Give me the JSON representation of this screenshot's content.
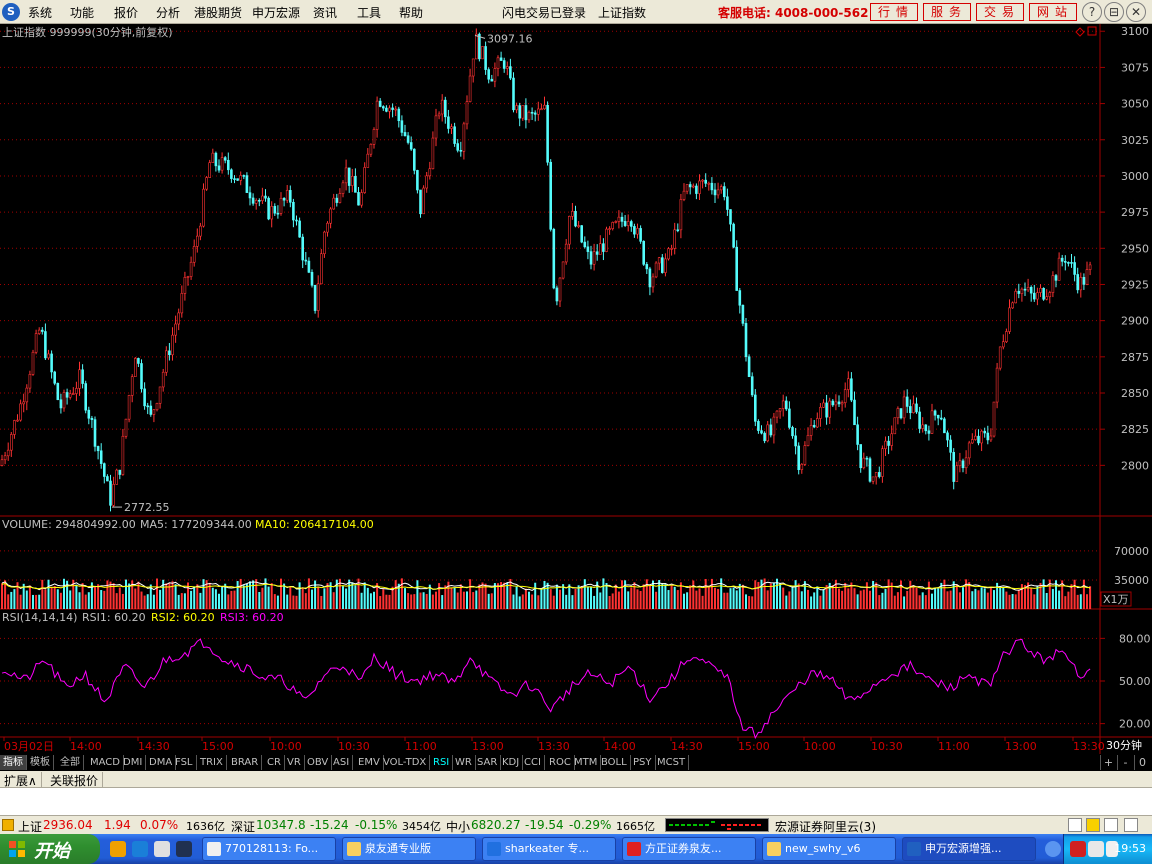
{
  "menu": {
    "logo_glyph": "S",
    "items": [
      "系统",
      "功能",
      "报价",
      "分析",
      "港股期货",
      "申万宏源",
      "资讯",
      "工具",
      "帮助"
    ],
    "status_center": [
      "闪电交易已登录",
      "上证指数"
    ],
    "service_phone": "客服电话: 4008-000-562",
    "quick_buttons": [
      "行情",
      "服务",
      "交易",
      "网站"
    ],
    "window_buttons": [
      "?",
      "⊟",
      "⧉",
      "✕"
    ]
  },
  "chart": {
    "title": "上证指数 999999(30分钟,前复权)",
    "high_label": "3097.16",
    "low_label": "2772.55",
    "price_axis": [
      "3100",
      "3075",
      "3050",
      "3025",
      "3000",
      "2975",
      "2950",
      "2925",
      "2900",
      "2875",
      "2850",
      "2825",
      "2800"
    ],
    "volume": {
      "label": "VOLUME: 294804992.00",
      "ma5": "MA5: 177209344.00",
      "ma10": "MA10: 206417104.00",
      "axis": [
        "70000",
        "35000"
      ],
      "unit": "X1万"
    },
    "rsi": {
      "label": "RSI(14,14,14)",
      "rsi1": "RSI1: 60.20",
      "rsi2": "RSI2: 60.20",
      "rsi3": "RSI3: 60.20",
      "axis": [
        "80.00",
        "50.00",
        "20.00"
      ]
    },
    "time_axis": [
      "03月02日",
      "14:00",
      "14:30",
      "15:00",
      "10:00",
      "10:30",
      "11:00",
      "13:00",
      "13:30",
      "14:00",
      "14:30",
      "15:00",
      "10:00",
      "10:30",
      "11:00",
      "13:00",
      "13:30"
    ],
    "period": "30分钟"
  },
  "chart_data": {
    "type": "candlestick",
    "title": "上证指数 999999(30分钟,前复权)",
    "ylim": [
      2765,
      3105
    ],
    "y_ticks": [
      2800,
      2825,
      2850,
      2875,
      2900,
      2925,
      2950,
      2975,
      3000,
      3025,
      3050,
      3075,
      3100
    ],
    "high": 3097.16,
    "low": 2772.55,
    "close_path": [
      [
        0,
        2800
      ],
      [
        20,
        2840
      ],
      [
        40,
        2895
      ],
      [
        60,
        2840
      ],
      [
        80,
        2860
      ],
      [
        95,
        2820
      ],
      [
        110,
        2776
      ],
      [
        120,
        2800
      ],
      [
        135,
        2880
      ],
      [
        150,
        2830
      ],
      [
        165,
        2870
      ],
      [
        180,
        2910
      ],
      [
        195,
        2950
      ],
      [
        210,
        3010
      ],
      [
        230,
        3005
      ],
      [
        250,
        2990
      ],
      [
        270,
        2975
      ],
      [
        290,
        2985
      ],
      [
        305,
        2940
      ],
      [
        315,
        2910
      ],
      [
        325,
        2965
      ],
      [
        345,
        3005
      ],
      [
        360,
        2980
      ],
      [
        378,
        3055
      ],
      [
        395,
        3045
      ],
      [
        410,
        3020
      ],
      [
        420,
        2975
      ],
      [
        440,
        3050
      ],
      [
        460,
        3020
      ],
      [
        475,
        3095
      ],
      [
        490,
        3070
      ],
      [
        505,
        3080
      ],
      [
        515,
        3045
      ],
      [
        530,
        3040
      ],
      [
        545,
        3045
      ],
      [
        555,
        2910
      ],
      [
        570,
        2975
      ],
      [
        590,
        2940
      ],
      [
        610,
        2960
      ],
      [
        630,
        2975
      ],
      [
        650,
        2930
      ],
      [
        670,
        2945
      ],
      [
        685,
        2990
      ],
      [
        705,
        2995
      ],
      [
        725,
        2990
      ],
      [
        740,
        2910
      ],
      [
        755,
        2830
      ],
      [
        770,
        2820
      ],
      [
        785,
        2845
      ],
      [
        800,
        2800
      ],
      [
        815,
        2835
      ],
      [
        830,
        2840
      ],
      [
        848,
        2855
      ],
      [
        860,
        2805
      ],
      [
        875,
        2790
      ],
      [
        890,
        2820
      ],
      [
        905,
        2845
      ],
      [
        925,
        2825
      ],
      [
        940,
        2840
      ],
      [
        955,
        2790
      ],
      [
        970,
        2815
      ],
      [
        990,
        2820
      ],
      [
        1000,
        2880
      ],
      [
        1015,
        2925
      ],
      [
        1035,
        2915
      ],
      [
        1050,
        2925
      ],
      [
        1065,
        2945
      ],
      [
        1080,
        2925
      ],
      [
        1092,
        2936.04
      ]
    ],
    "volume_axis": [
      70000,
      35000
    ],
    "rsi_axis": [
      80,
      50,
      20
    ],
    "rsi_path": [
      [
        0,
        60
      ],
      [
        25,
        50
      ],
      [
        45,
        65
      ],
      [
        65,
        45
      ],
      [
        85,
        55
      ],
      [
        105,
        35
      ],
      [
        125,
        60
      ],
      [
        145,
        45
      ],
      [
        165,
        65
      ],
      [
        185,
        70
      ],
      [
        205,
        78
      ],
      [
        225,
        65
      ],
      [
        245,
        60
      ],
      [
        265,
        52
      ],
      [
        285,
        50
      ],
      [
        305,
        35
      ],
      [
        325,
        55
      ],
      [
        345,
        62
      ],
      [
        360,
        48
      ],
      [
        375,
        68
      ],
      [
        395,
        55
      ],
      [
        415,
        50
      ],
      [
        435,
        55
      ],
      [
        455,
        48
      ],
      [
        470,
        68
      ],
      [
        490,
        50
      ],
      [
        510,
        40
      ],
      [
        530,
        48
      ],
      [
        552,
        30
      ],
      [
        570,
        45
      ],
      [
        590,
        55
      ],
      [
        610,
        48
      ],
      [
        630,
        60
      ],
      [
        650,
        38
      ],
      [
        670,
        50
      ],
      [
        690,
        68
      ],
      [
        715,
        58
      ],
      [
        730,
        50
      ],
      [
        740,
        20
      ],
      [
        755,
        12
      ],
      [
        770,
        25
      ],
      [
        790,
        40
      ],
      [
        810,
        55
      ],
      [
        830,
        52
      ],
      [
        850,
        35
      ],
      [
        870,
        45
      ],
      [
        890,
        55
      ],
      [
        910,
        60
      ],
      [
        930,
        50
      ],
      [
        950,
        45
      ],
      [
        970,
        55
      ],
      [
        990,
        45
      ],
      [
        1005,
        70
      ],
      [
        1020,
        78
      ],
      [
        1040,
        65
      ],
      [
        1060,
        70
      ],
      [
        1080,
        55
      ],
      [
        1092,
        60
      ]
    ]
  },
  "indicator_tabs": [
    "指标",
    "模板",
    "全部",
    "MACD",
    "DMI",
    "DMA",
    "FSL",
    "TRIX",
    "BRAR",
    "CR",
    "VR",
    "OBV",
    "ASI",
    "EMV",
    "VOL-TDX",
    "RSI",
    "WR",
    "SAR",
    "KDJ",
    "CCI",
    "ROC",
    "MTM",
    "BOLL",
    "PSY",
    "MCST"
  ],
  "active_tab": "RSI",
  "zoom_controls": [
    "+",
    "-",
    "0"
  ],
  "ext_tabs": [
    "扩展∧",
    "关联报价"
  ],
  "status": {
    "sh_label": "上证",
    "sh_value": "2936.04",
    "sh_change": "1.94",
    "sh_pct": "0.07%",
    "sh_amount": "1636亿",
    "sz_label": "深证",
    "sz_value": "10347.8",
    "sz_change": "-15.24",
    "sz_pct": "-0.15%",
    "sz_amount": "3454亿",
    "zx_label": "中小",
    "zx_value": "6820.27",
    "zx_change": "-19.54",
    "zx_pct": "-0.29%",
    "zx_amount": "1665亿",
    "broker": "宏源证券阿里云(3)"
  },
  "taskbar": {
    "start": "开始",
    "tasks": [
      "770128113: Fo...",
      "泉友通专业版",
      "sharkeater 专...",
      "方正证券泉友...",
      "new_swhy_v6",
      "申万宏源增强..."
    ],
    "clock": "19:53"
  },
  "colors": {
    "up": "#ff3232",
    "down": "#54fcfc",
    "grid": "#a00000",
    "axis_text": "#c0c0c0",
    "rsi": "#ff00ff",
    "ma5": "#ffffff",
    "ma10": "#ffff00"
  }
}
